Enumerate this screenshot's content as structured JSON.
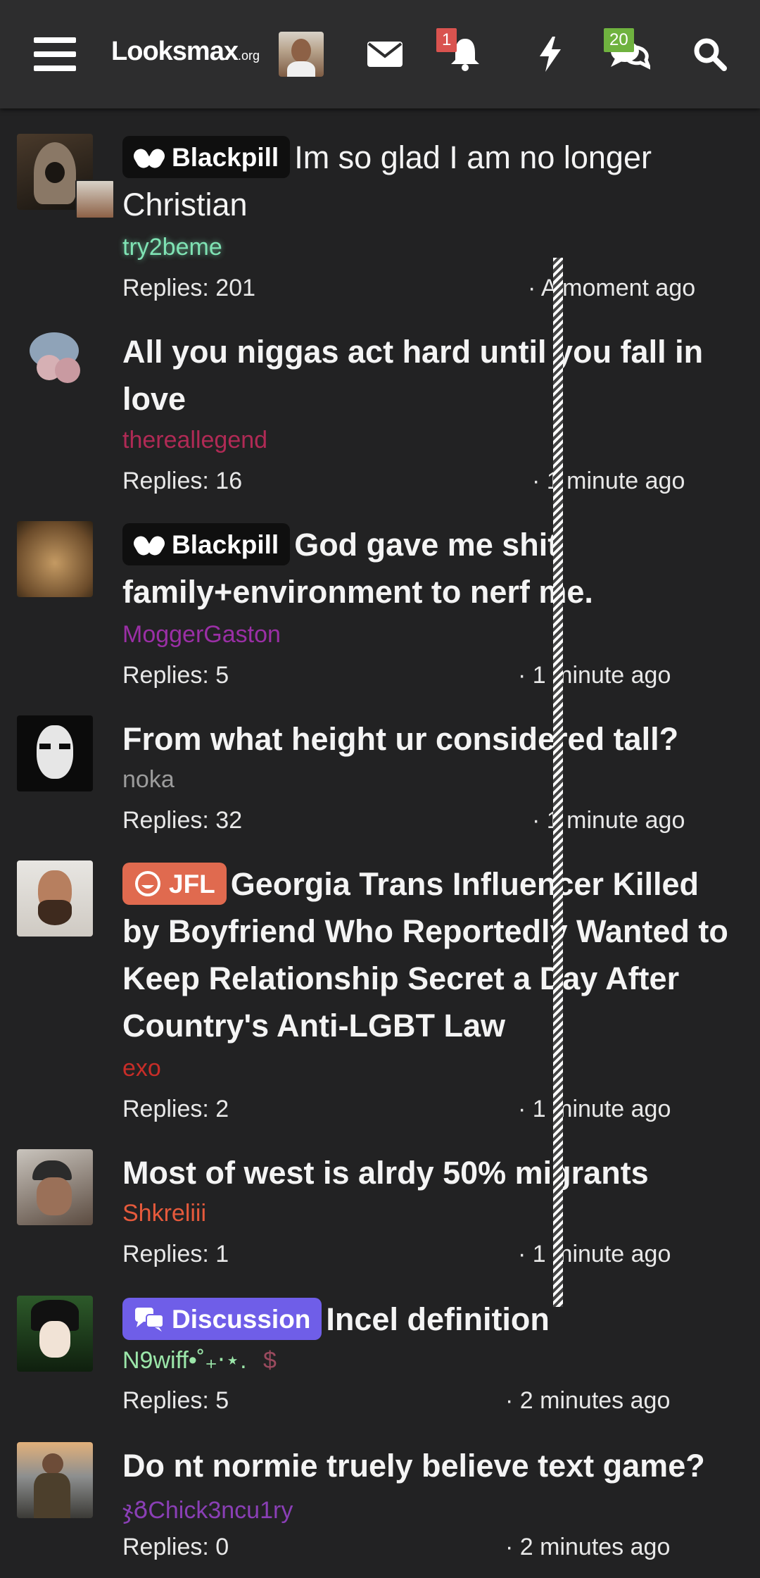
{
  "header": {
    "logo_main": "Lo",
    "logo_o": "o",
    "logo_rest": "ksmax",
    "logo_suffix": ".org",
    "notification_count": "1",
    "conversation_count": "20",
    "icons": [
      "menu-icon",
      "user-avatar",
      "envelope-icon",
      "bell-icon",
      "bolt-icon",
      "chat-bubbles-icon",
      "search-icon"
    ]
  },
  "threads": [
    {
      "prefix": "Blackpill",
      "title": "Im so glad I am no longer Christian",
      "author": "try2beme",
      "author_color": "#7fe3b4",
      "replies": "Replies: 201",
      "time": "· A moment ago",
      "bold": false
    },
    {
      "prefix": "",
      "title": "All you niggas act hard until you fall in love",
      "author": "thereallegend",
      "author_color": "#b02a55",
      "replies": "Replies: 16",
      "time": "· 1 minute ago",
      "bold": true
    },
    {
      "prefix": "Blackpill",
      "title": "God gave me shit family+environment to nerf me.",
      "author": "MoggerGaston",
      "author_color": "#9a2fa5",
      "replies": "Replies: 5",
      "time": "· 1 minute ago",
      "bold": true
    },
    {
      "prefix": "",
      "title": "From what height ur considered tall?",
      "author": "noka",
      "author_color": "#9c9c9c",
      "replies": "Replies: 32",
      "time": "· 1 minute ago",
      "bold": true
    },
    {
      "prefix": "JFL",
      "title": "Georgia Trans Influencer Killed by Boyfriend Who Reportedly Wanted to Keep Relationship Secret a Day After Country's Anti-LGBT Law",
      "author": "exo",
      "author_color": "#c72d28",
      "replies": "Replies: 2",
      "time": "· 1 minute ago",
      "bold": true
    },
    {
      "prefix": "",
      "title": "Most of west is alrdy 50% migrants",
      "author": "Shkreliii",
      "author_color": "#e65a3c",
      "replies": "Replies: 1",
      "time": "· 1 minute ago",
      "bold": true
    },
    {
      "prefix": "Discussion",
      "title": "Incel definition",
      "author": "N9wiff•˚₊‧⋆.",
      "author_color": "#9be6a9",
      "author_extra": "$",
      "replies": "Replies: 5",
      "time": "· 2 minutes ago",
      "bold": true
    },
    {
      "prefix": "",
      "title": "Do nt normie truely believe text game?",
      "author": "ჯᲒChick3ncu1ry",
      "author_color": "#8a3fb5",
      "replies": "Replies: 0",
      "time": "· 2 minutes ago",
      "bold": true
    }
  ],
  "colors": {
    "blackpill": "#0f0f0f",
    "jfl": "#e06a4f",
    "discussion": "#6f5ee8"
  }
}
